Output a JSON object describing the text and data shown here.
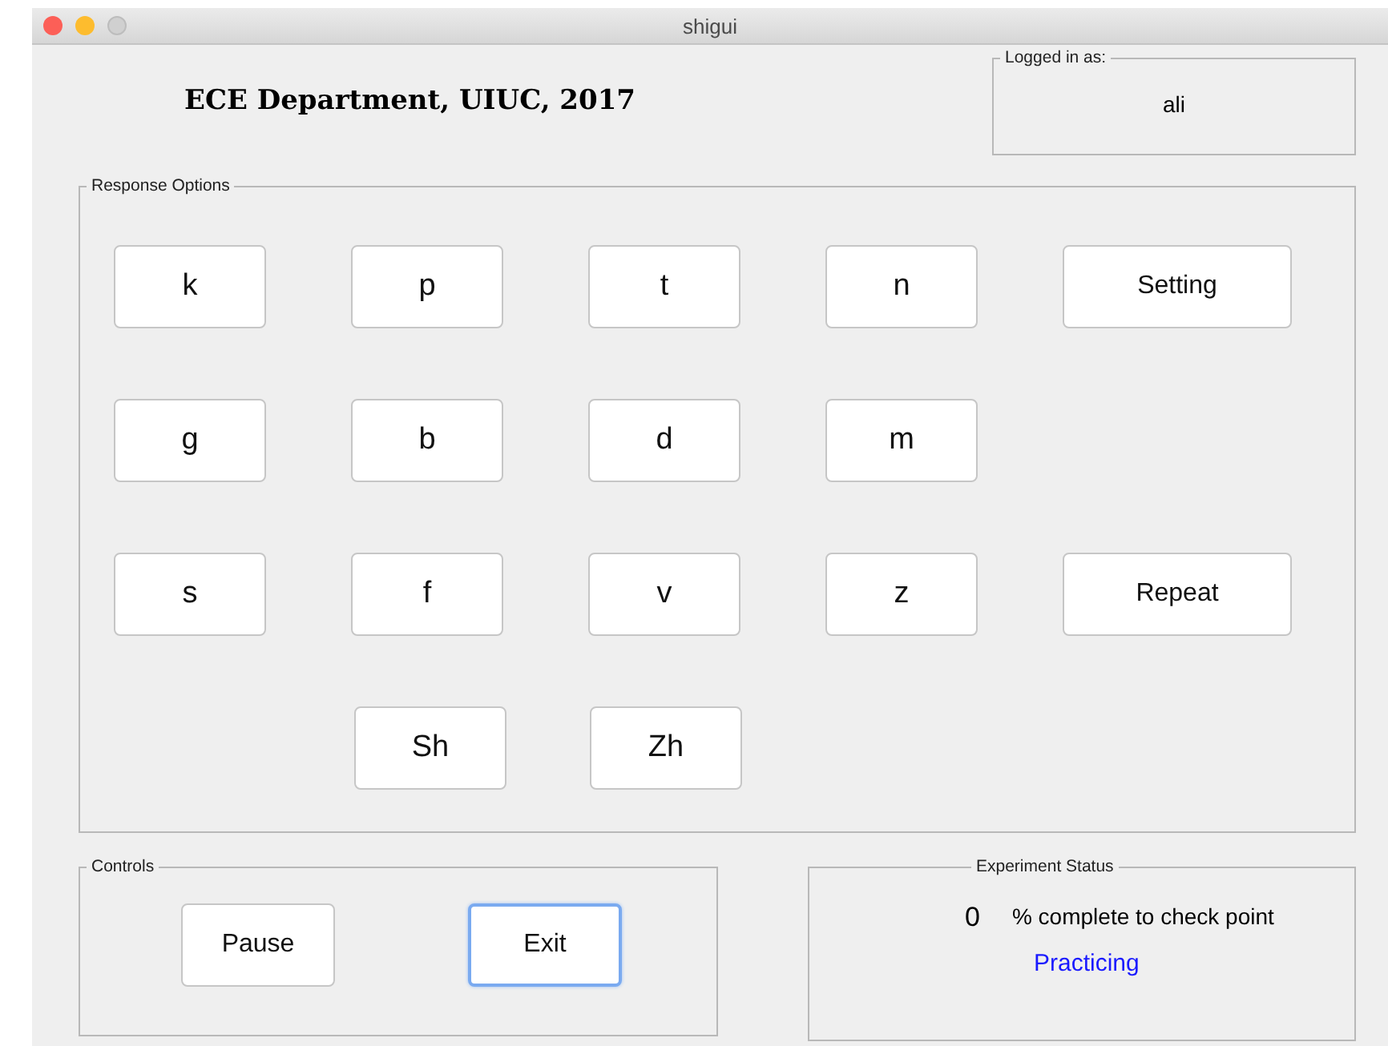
{
  "window": {
    "title": "shigui"
  },
  "header": "ECE Department, UIUC, 2017",
  "login": {
    "legend": "Logged in as:",
    "user": "ali"
  },
  "response_options": {
    "legend": "Response Options",
    "rows": [
      {
        "buttons": [
          {
            "label": "k",
            "kind": "phoneme"
          },
          {
            "label": "p",
            "kind": "phoneme"
          },
          {
            "label": "t",
            "kind": "phoneme"
          },
          {
            "label": "n",
            "kind": "phoneme"
          },
          {
            "label": "Setting",
            "kind": "action"
          }
        ]
      },
      {
        "buttons": [
          {
            "label": "g",
            "kind": "phoneme"
          },
          {
            "label": "b",
            "kind": "phoneme"
          },
          {
            "label": "d",
            "kind": "phoneme"
          },
          {
            "label": "m",
            "kind": "phoneme"
          }
        ]
      },
      {
        "buttons": [
          {
            "label": "s",
            "kind": "phoneme"
          },
          {
            "label": "f",
            "kind": "phoneme"
          },
          {
            "label": "v",
            "kind": "phoneme"
          },
          {
            "label": "z",
            "kind": "phoneme"
          },
          {
            "label": "Repeat",
            "kind": "action"
          }
        ]
      },
      {
        "buttons": [
          {
            "label": "Sh",
            "kind": "phoneme"
          },
          {
            "label": "Zh",
            "kind": "phoneme"
          }
        ]
      }
    ]
  },
  "controls": {
    "legend": "Controls",
    "buttons": [
      {
        "label": "Pause",
        "focused": false
      },
      {
        "label": "Exit",
        "focused": true
      }
    ]
  },
  "status": {
    "legend": "Experiment Status",
    "percent": "0",
    "caption": "% complete to check point",
    "mode": "Practicing"
  }
}
